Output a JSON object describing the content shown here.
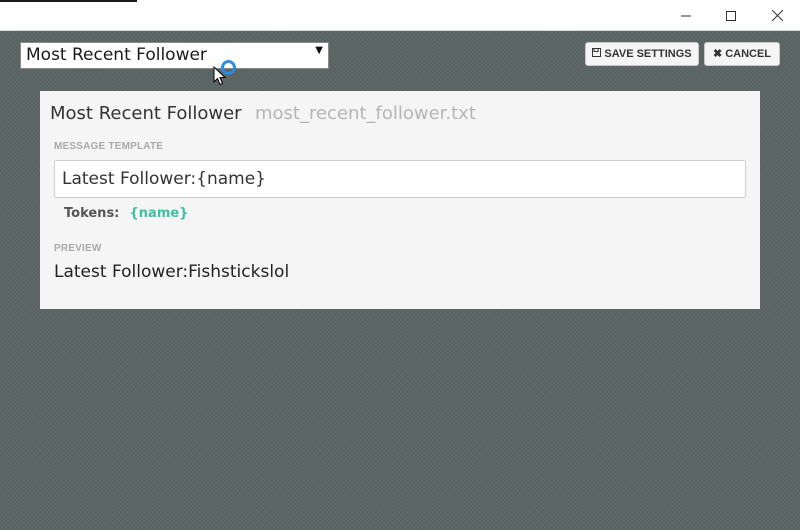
{
  "selector": {
    "value": "Most Recent Follower"
  },
  "toolbar": {
    "save_label": "SAVE SETTINGS",
    "cancel_label": "CANCEL"
  },
  "panel": {
    "title": "Most Recent Follower",
    "filename": "most_recent_follower.txt",
    "template_label": "MESSAGE TEMPLATE",
    "template_value": "Latest Follower:{name}",
    "tokens_label": "Tokens:",
    "tokens": [
      "{name}"
    ],
    "preview_label": "PREVIEW",
    "preview_value": "Latest Follower:Fishstickslol"
  },
  "colors": {
    "background": "#5b6563",
    "panel": "#f5f5f5",
    "token": "#3dbfa0",
    "spinner": "#2e8be0"
  },
  "icons": {
    "minimize": "minimize-icon",
    "maximize": "maximize-icon",
    "close": "close-icon",
    "dropdown": "caret-down-icon",
    "save": "floppy-disk-icon",
    "cancel": "x-icon",
    "loading": "spinner-icon",
    "cursor": "mouse-pointer-icon"
  }
}
